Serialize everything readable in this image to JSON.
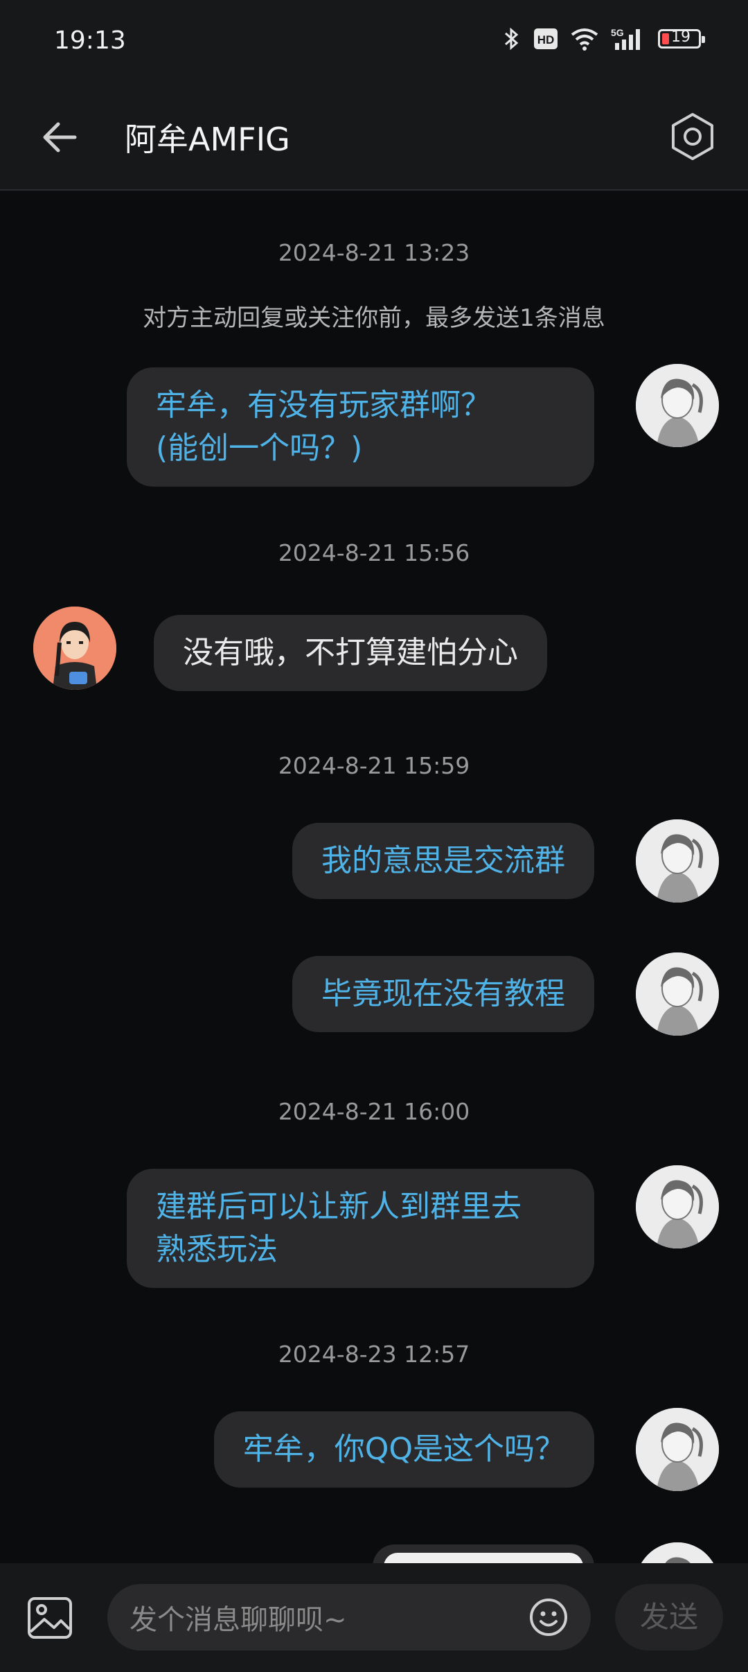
{
  "status": {
    "time": "19:13",
    "battery": "19",
    "network": "5G",
    "hd": "HD"
  },
  "header": {
    "title": "阿牟AMFIG"
  },
  "notice": "对方主动回复或关注你前，最多发送1条消息",
  "timestamps": [
    "2024-8-21 13:23",
    "2024-8-21 15:56",
    "2024-8-21 15:59",
    "2024-8-21 16:00",
    "2024-8-23 12:57"
  ],
  "messages": [
    {
      "from": "me",
      "text": "牢牟，有没有玩家群啊？\n(能创一个吗？)"
    },
    {
      "from": "them",
      "text": "没有哦，不打算建怕分心"
    },
    {
      "from": "me",
      "text": "我的意思是交流群"
    },
    {
      "from": "me",
      "text": "毕竟现在没有教程"
    },
    {
      "from": "me",
      "text": "建群后可以让新人到群里去\n熟悉玩法"
    },
    {
      "from": "me",
      "text": "牢牟，你QQ是这个吗？"
    }
  ],
  "input": {
    "placeholder": "发个消息聊聊呗~",
    "send_label": "发送"
  },
  "colors": {
    "accent": "#4fb3e8",
    "bubble": "#2a2a2c",
    "background": "#0b0c0e"
  }
}
